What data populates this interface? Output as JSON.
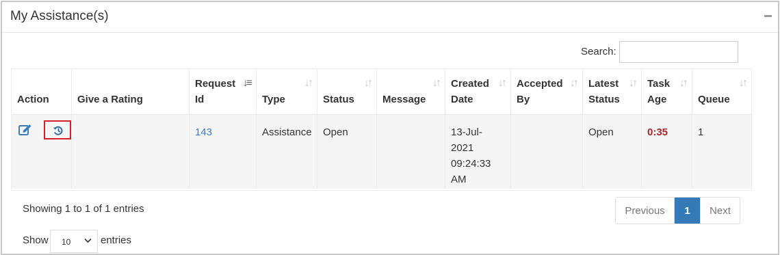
{
  "panel": {
    "title": "My Assistance(s)"
  },
  "search": {
    "label": "Search:",
    "value": "",
    "placeholder": ""
  },
  "table": {
    "columns": [
      {
        "label": "Action",
        "sortable": false
      },
      {
        "label": "Give a Rating",
        "sortable": false
      },
      {
        "label": "Request\nId",
        "sortable": true,
        "active": true
      },
      {
        "label": "Type",
        "sortable": true
      },
      {
        "label": "Status",
        "sortable": true
      },
      {
        "label": "Message",
        "sortable": true
      },
      {
        "label": "Created\nDate",
        "sortable": true
      },
      {
        "label": "Accepted\nBy",
        "sortable": true
      },
      {
        "label": "Latest\nStatus",
        "sortable": true
      },
      {
        "label": "Task\nAge",
        "sortable": true
      },
      {
        "label": "Queue",
        "sortable": true
      }
    ],
    "rows": [
      {
        "rating": "",
        "request_id": "143",
        "type": "Assistance",
        "status": "Open",
        "message": "",
        "created_date": "13-Jul-\n2021\n09:24:33\nAM",
        "accepted_by": "",
        "latest_status": "Open",
        "task_age": "0:35",
        "queue": "1"
      }
    ]
  },
  "footer": {
    "info": "Showing 1 to 1 of 1 entries",
    "pagination": {
      "previous": "Previous",
      "current": "1",
      "next": "Next"
    },
    "length": {
      "show": "Show",
      "value": "10",
      "entries": "entries"
    }
  },
  "icons": {
    "edit": "edit-icon",
    "history": "history-icon",
    "collapse": "minus-icon"
  },
  "colors": {
    "link": "#3a7cbd",
    "accent": "#337ab7",
    "age": "#a4262c",
    "highlight": "#d8202a"
  }
}
